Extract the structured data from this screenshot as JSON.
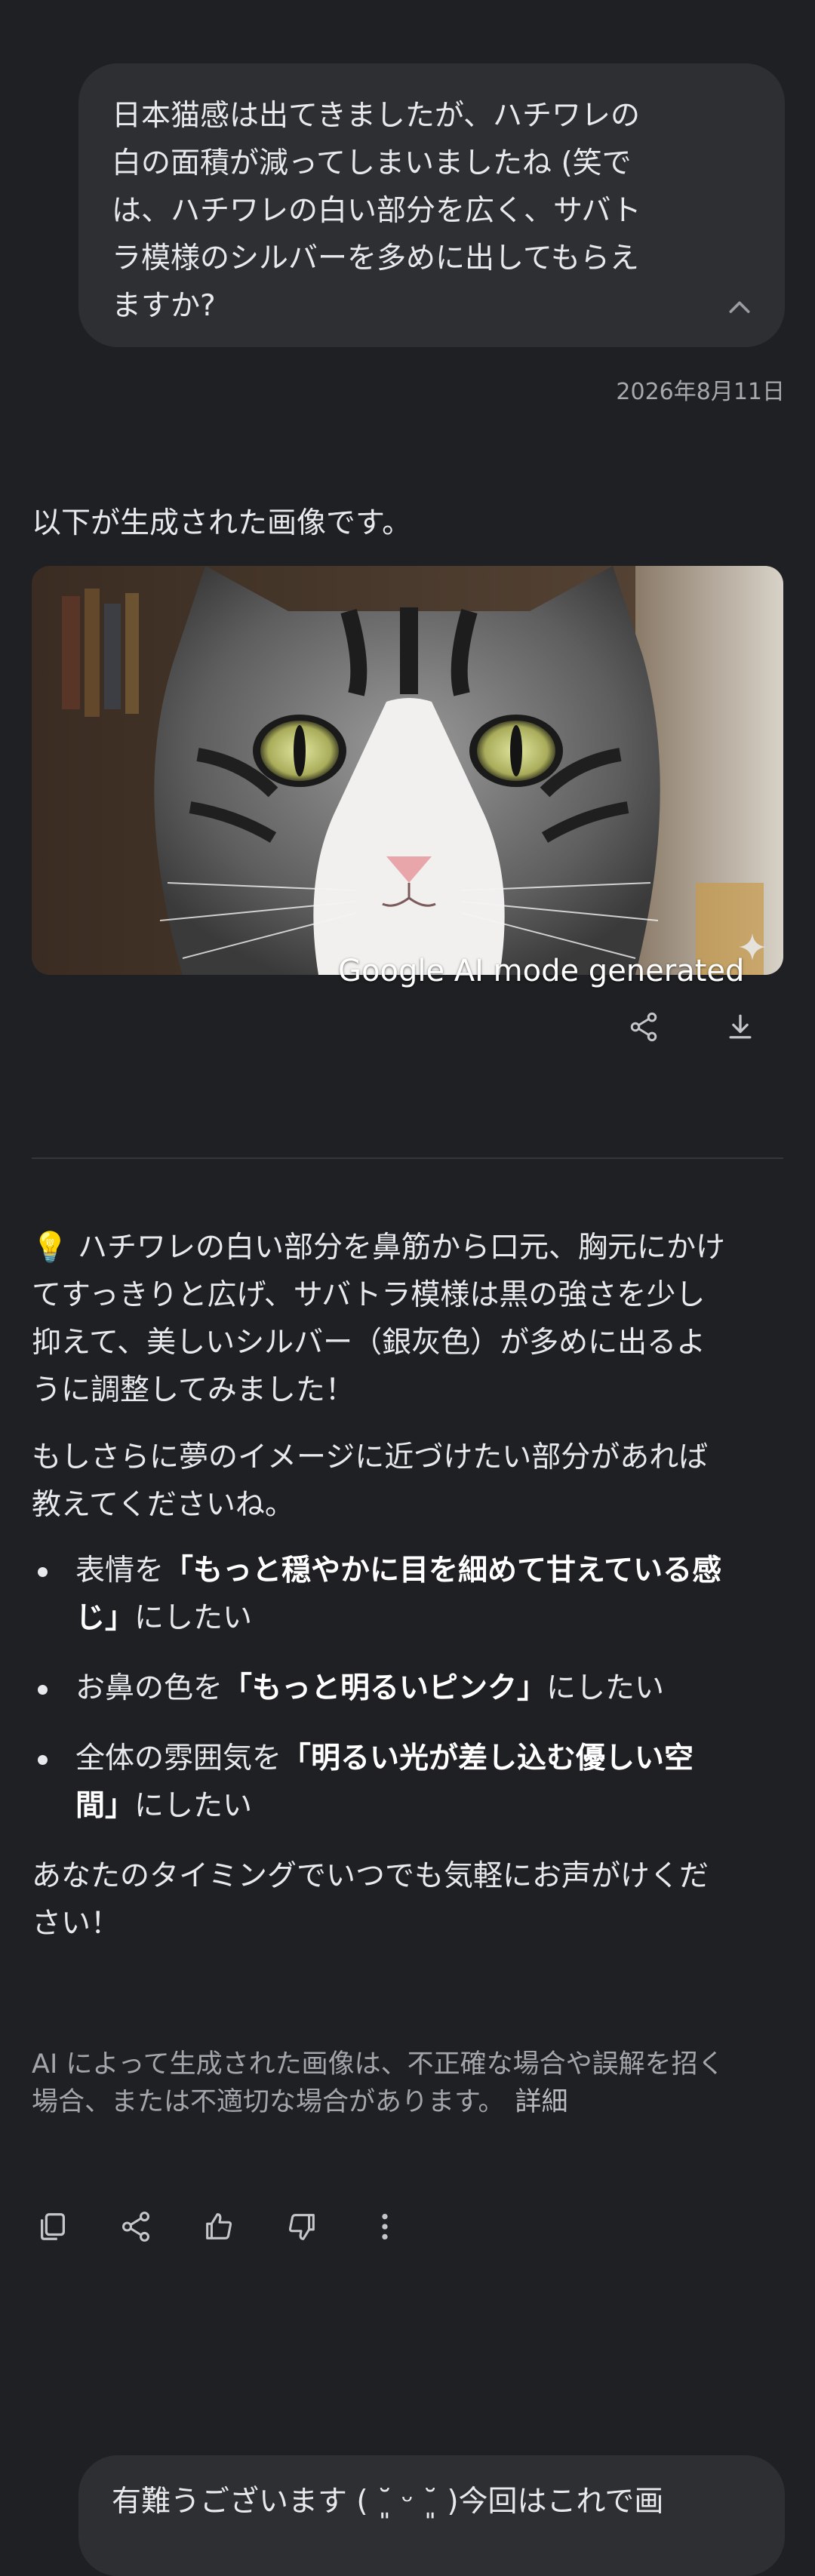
{
  "user_message": {
    "lines": [
      "日本猫感は出てきましたが、ハチワレの",
      "白の面積が減ってしまいましたね (笑で",
      "は、ハチワレの白い部分を広く、サバト",
      "ラ模様のシルバーを多めに出してもらえ",
      "ますか?"
    ],
    "collapse_icon": "chevron-up-icon",
    "timestamp": "2026年8月11日"
  },
  "response": {
    "intro": "以下が生成された画像です。",
    "image": {
      "description_icon": "cat-photo",
      "watermark": "Google AI mode generated",
      "sparkle_icon": "sparkle-icon",
      "share_icon": "share-icon",
      "download_icon": "download-icon"
    },
    "paragraph1_lines": [
      "💡 ハチワレの白い部分を鼻筋から口元、胸元にかけ",
      "てすっきりと広げ、サバトラ模様は黒の強さを少し",
      "抑えて、美しいシルバー（銀灰色）が多めに出るよ",
      "うに調整してみました！"
    ],
    "paragraph2_lines": [
      "もしさらに夢のイメージに近づけたい部分があれば",
      "教えてくださいね。"
    ],
    "bullets": [
      {
        "prefix": "表情を",
        "bold_line1": "「もっと穏やかに目を細めて甘えている感",
        "bold_line2": "じ」",
        "suffix": "にしたい"
      },
      {
        "prefix": "お鼻の色を",
        "bold_line1": "「もっと明るいピンク」",
        "bold_line2": "",
        "suffix": "にしたい"
      },
      {
        "prefix": "全体の雰囲気を",
        "bold_line1": "「明るい光が差し込む優しい空",
        "bold_line2": "間」",
        "suffix": "にしたい"
      }
    ],
    "closing_lines": [
      "あなたのタイミングでいつでも気軽にお声がけくだ",
      "さい！"
    ],
    "disclaimer_line1": "AI によって生成された画像は、不正確な場合や誤解を招く",
    "disclaimer_line2": "場合、または不適切な場合があります。",
    "disclaimer_link": "詳細",
    "actions": [
      "copy-icon",
      "share-icon",
      "thumbs-up-icon",
      "thumbs-down-icon",
      "more-vertical-icon"
    ]
  },
  "next_user_message": "有難うございます ( ˘͈ ᵕ ˘͈ )今回はこれで画"
}
